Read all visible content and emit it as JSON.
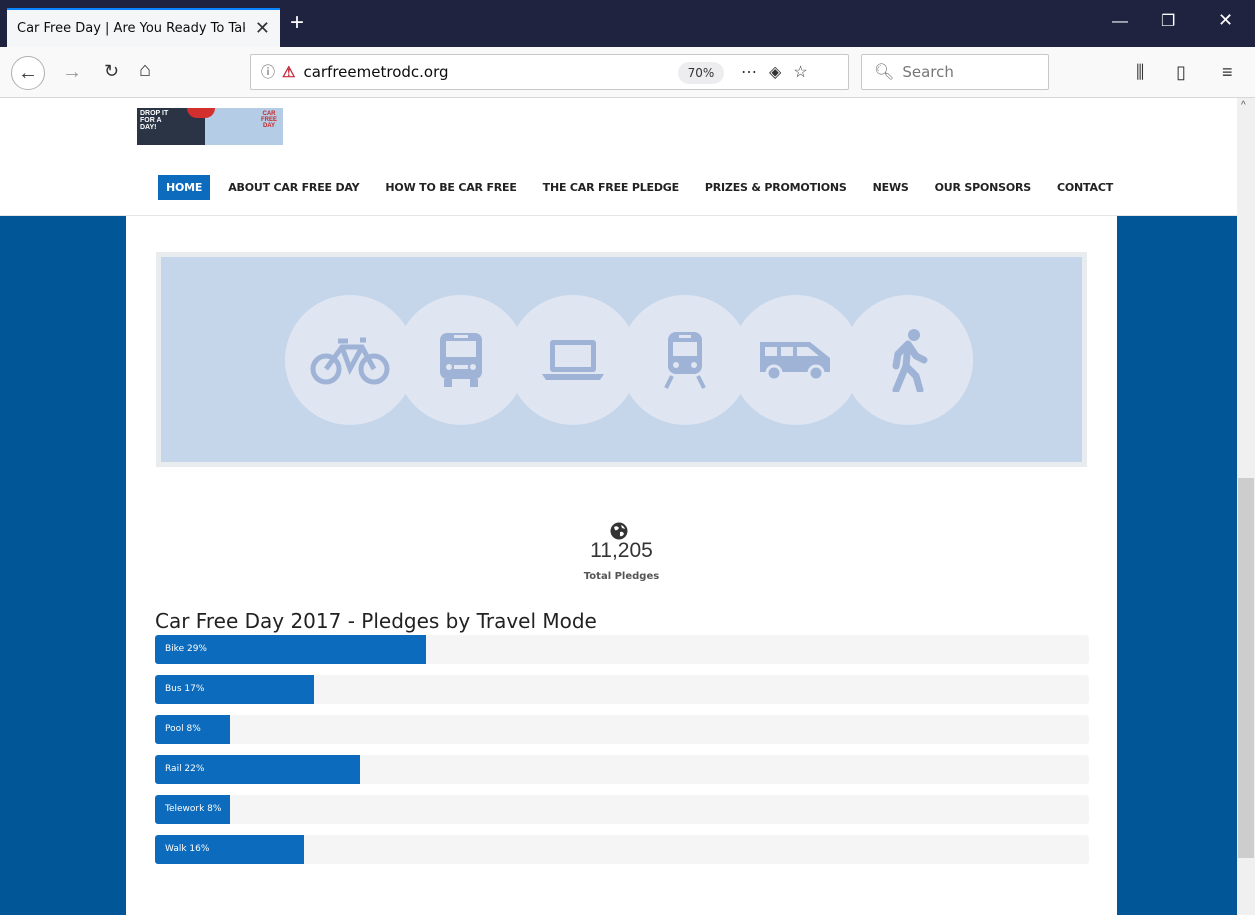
{
  "browser": {
    "tab_title": "Car Free Day | Are You Ready To Tak",
    "new_tab": "+",
    "url": "carfreemetrodc.org",
    "zoom": "70%",
    "search_placeholder": "Search"
  },
  "site": {
    "logo": {
      "line1": "DROP IT",
      "line2": "FOR A",
      "line3": "DAY!",
      "right": "CAR FREE DAY"
    },
    "menu": [
      {
        "label": "HOME",
        "active": true
      },
      {
        "label": "ABOUT CAR FREE DAY"
      },
      {
        "label": "HOW TO BE CAR FREE"
      },
      {
        "label": "THE CAR FREE PLEDGE"
      },
      {
        "label": "PRIZES & PROMOTIONS"
      },
      {
        "label": "NEWS"
      },
      {
        "label": "OUR SPONSORS"
      },
      {
        "label": "CONTACT"
      }
    ],
    "hero_icons": [
      "bicycle-icon",
      "bus-icon",
      "laptop-icon",
      "train-icon",
      "van-icon",
      "walking-person-icon"
    ]
  },
  "stats": {
    "total": "11,205",
    "label": "Total Pledges"
  },
  "chart_data": {
    "type": "bar",
    "title": "Car Free Day 2017 - Pledges by Travel Mode",
    "categories": [
      "Bike",
      "Bus",
      "Pool",
      "Rail",
      "Telework",
      "Walk"
    ],
    "values": [
      29,
      17,
      8,
      22,
      8,
      16
    ],
    "labels": [
      "Bike 29%",
      "Bus 17%",
      "Pool 8%",
      "Rail 22%",
      "Telework 8%",
      "Walk 16%"
    ],
    "ylim": [
      0,
      100
    ],
    "colors": {
      "bar": "#0c6bbc",
      "track": "#f5f5f5"
    }
  },
  "colors": {
    "page_bg": "#005696",
    "accent": "#0c6bbc",
    "hero": "#c5d5ea"
  }
}
